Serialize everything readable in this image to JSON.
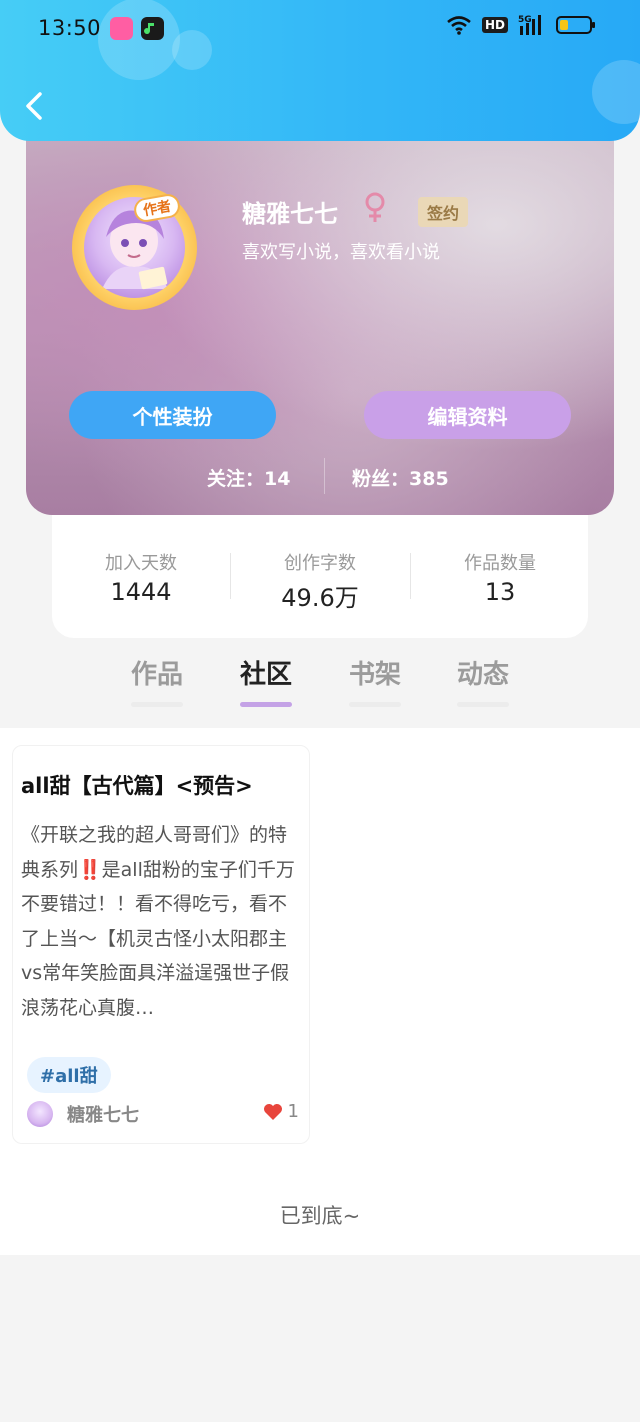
{
  "status_bar": {
    "time": "13:50",
    "network_badge": "HD",
    "network_type": "5G"
  },
  "profile": {
    "username": "糖雅七七",
    "gender_symbol": "♀",
    "sign_badge": "签约",
    "author_badge": "作者",
    "bio": "喜欢写小说，喜欢看小说",
    "buttons": {
      "dress_up": "个性装扮",
      "edit_profile": "编辑资料"
    },
    "follow_label": "关注：",
    "follow_count": "14",
    "fans_label": "粉丝：",
    "fans_count": "385"
  },
  "stats": [
    {
      "label": "加入天数",
      "value": "1444"
    },
    {
      "label": "创作字数",
      "value": "49.6万"
    },
    {
      "label": "作品数量",
      "value": "13"
    }
  ],
  "tabs": [
    {
      "label": "作品",
      "active": false
    },
    {
      "label": "社区",
      "active": true
    },
    {
      "label": "书架",
      "active": false
    },
    {
      "label": "动态",
      "active": false
    }
  ],
  "post": {
    "title": "all甜【古代篇】<预告>",
    "body": "《开联之我的超人哥哥们》的特典系列‼️是all甜粉的宝子们千万不要错过！！看不得吃亏，看不了上当～【机灵古怪小太阳郡主vs常年笑脸面具洋溢逞强世子假浪荡花心真腹…",
    "hashtag": "#all甜",
    "author": "糖雅七七",
    "likes": "1"
  },
  "end_text": "已到底~",
  "colors": {
    "header_blue": "#33b7f7",
    "dress_button": "#3fa6f5",
    "edit_button": "#c9a0e8",
    "tab_underline_active": "#c4a2e6"
  },
  "icons": [
    "back-arrow-icon",
    "gender-female-icon",
    "heart-icon",
    "wifi-icon",
    "signal-icon",
    "battery-icon"
  ]
}
